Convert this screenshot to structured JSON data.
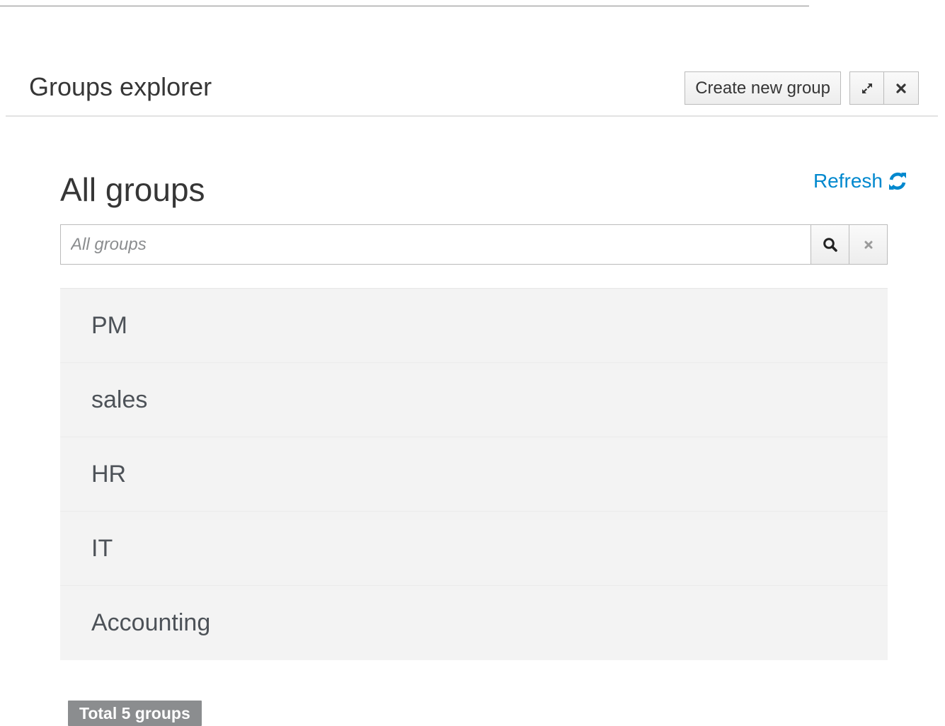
{
  "header": {
    "title": "Groups explorer",
    "create_button_label": "Create new group",
    "expand_icon": "expand-icon",
    "close_icon": "close-icon"
  },
  "main": {
    "section_title": "All groups",
    "refresh_label": "Refresh",
    "refresh_icon": "refresh-icon",
    "search": {
      "placeholder": "All groups",
      "value": "",
      "search_icon": "search-icon",
      "clear_icon": "clear-icon"
    },
    "groups": [
      {
        "name": "PM"
      },
      {
        "name": "sales"
      },
      {
        "name": "HR"
      },
      {
        "name": "IT"
      },
      {
        "name": "Accounting"
      }
    ],
    "total_label": "Total 5 groups"
  },
  "colors": {
    "accent": "#0088ce",
    "list_background": "#f3f3f3",
    "badge_background": "#8b8d8f"
  }
}
